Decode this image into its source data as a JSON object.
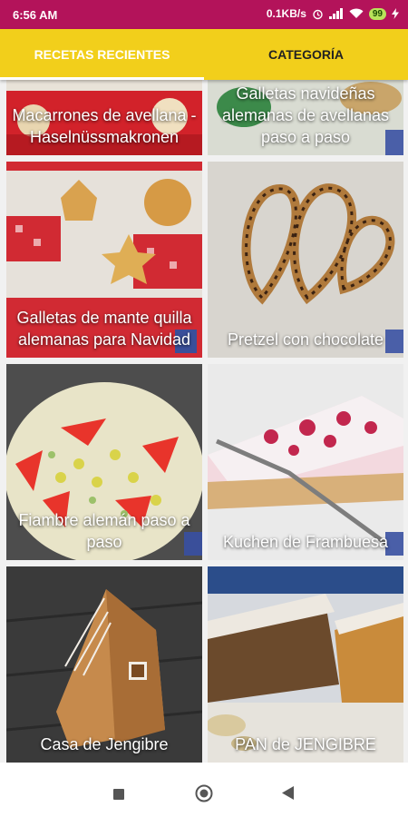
{
  "status_bar": {
    "time": "6:56 AM",
    "network_speed": "0.1KB/s",
    "battery": "99"
  },
  "tabs": [
    {
      "label": "RECETAS RECIENTES",
      "active": true
    },
    {
      "label": "CATEGORÍA",
      "active": false
    }
  ],
  "recipes": [
    {
      "title": "Macarrones de avellana - Haselnüssmakronen"
    },
    {
      "title": "Galletas navideñas alemanas de avellanas paso a paso"
    },
    {
      "title": "Galletas de mante quilla alemanas para Navidad"
    },
    {
      "title": "Pretzel con chocolate"
    },
    {
      "title": "Fiambre alemán paso a paso"
    },
    {
      "title": "Kuchen de Frambuesa"
    },
    {
      "title": "Casa de Jengibre"
    },
    {
      "title": "PAN de JENGIBRE"
    }
  ],
  "nav": {
    "recents": "square-icon",
    "home": "circle-icon",
    "back": "triangle-back-icon"
  }
}
